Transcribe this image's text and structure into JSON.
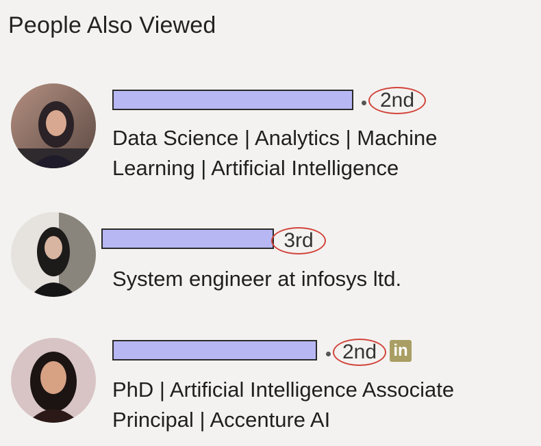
{
  "section": {
    "title": "People Also Viewed"
  },
  "people": [
    {
      "degree": "2nd",
      "headline": "Data Science | Analytics | Machine Learning | Artificial Intelligence",
      "avatar_icon": "profile-photo"
    },
    {
      "degree": "3rd",
      "headline": "System engineer at infosys ltd.",
      "avatar_icon": "profile-photo"
    },
    {
      "degree": "2nd",
      "headline": "PhD | Artificial Intelligence Associate Principal | Accenture AI",
      "avatar_icon": "profile-photo",
      "badge": "in",
      "badge_icon": "linkedin-icon"
    }
  ],
  "colors": {
    "background": "#f3f2f0",
    "redacted_name": "#b7b7f4",
    "degree_circle": "#d2433a",
    "linkedin_badge": "#a99e64"
  }
}
